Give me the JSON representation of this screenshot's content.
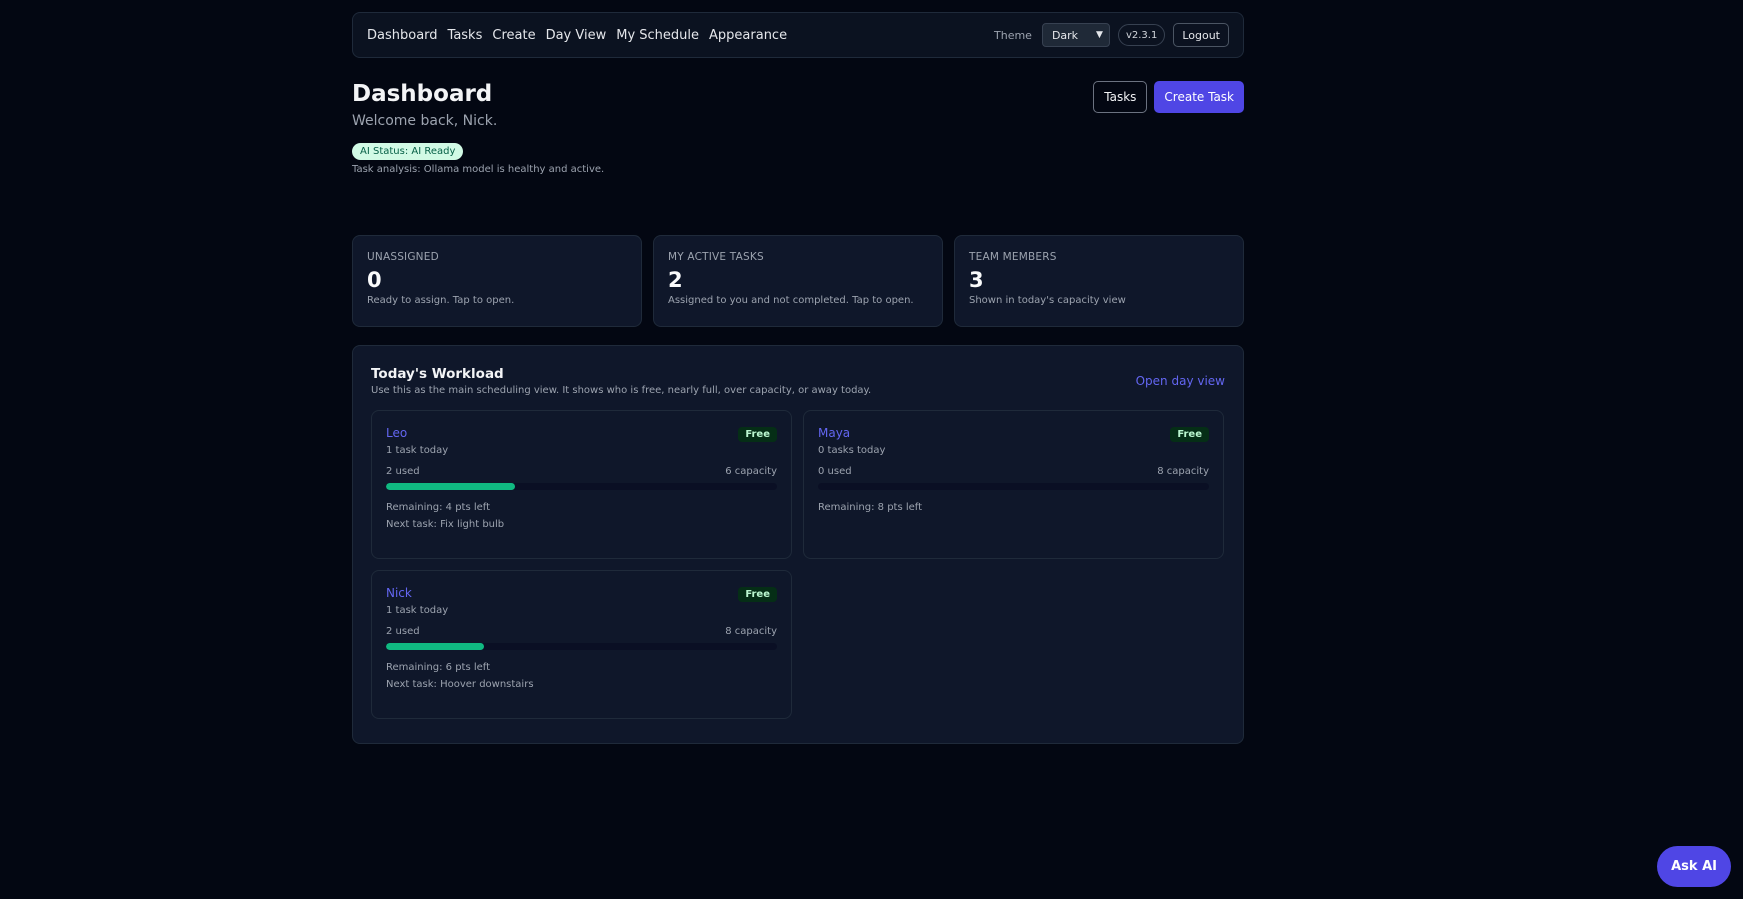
{
  "nav": {
    "links": [
      "Dashboard",
      "Tasks",
      "Create",
      "Day View",
      "My Schedule",
      "Appearance"
    ],
    "theme_label": "Theme",
    "theme_value": "Dark",
    "version": "v2.3.1",
    "logout": "Logout"
  },
  "header": {
    "title": "Dashboard",
    "welcome": "Welcome back, Nick.",
    "ai_status": "AI Status: AI Ready",
    "ai_description": "Task analysis: Ollama model is healthy and active.",
    "tasks_button": "Tasks",
    "create_button": "Create Task"
  },
  "stats": [
    {
      "label": "UNASSIGNED",
      "value": "0",
      "desc": "Ready to assign. Tap to open."
    },
    {
      "label": "MY ACTIVE TASKS",
      "value": "2",
      "desc": "Assigned to you and not completed. Tap to open."
    },
    {
      "label": "TEAM MEMBERS",
      "value": "3",
      "desc": "Shown in today's capacity view"
    }
  ],
  "workload": {
    "title": "Today's Workload",
    "description": "Use this as the main scheduling view. It shows who is free, nearly full, over capacity, or away today.",
    "open_link": "Open day view",
    "members": [
      {
        "name": "Leo",
        "status": "Free",
        "tasks": "1 task today",
        "used": "2 used",
        "capacity": "6 capacity",
        "fill": 0.33,
        "remaining": "Remaining: 4 pts left",
        "next_task": "Next task: Fix light bulb"
      },
      {
        "name": "Maya",
        "status": "Free",
        "tasks": "0 tasks today",
        "used": "0 used",
        "capacity": "8 capacity",
        "fill": 0,
        "remaining": "Remaining: 8 pts left",
        "next_task": ""
      },
      {
        "name": "Nick",
        "status": "Free",
        "tasks": "1 task today",
        "used": "2 used",
        "capacity": "8 capacity",
        "fill": 0.25,
        "remaining": "Remaining: 6 pts left",
        "next_task": "Next task: Hoover downstairs"
      }
    ]
  },
  "ask_ai": "Ask AI",
  "colors": {
    "accent": "#4f46e5",
    "progress": "#10b981",
    "background": "#030712",
    "card": "#0f172a"
  }
}
